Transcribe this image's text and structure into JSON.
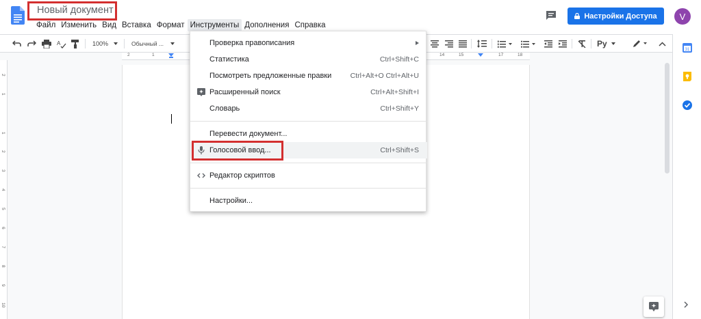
{
  "app": {
    "doc_title": "Новый документ",
    "share_label": "Настройки Доступа",
    "avatar_letter": "V",
    "accent_color": "#1a73e8",
    "highlight_box_color": "#d32f2f"
  },
  "menubar": {
    "items": [
      "Файл",
      "Изменить",
      "Вид",
      "Вставка",
      "Формат",
      "Инструменты",
      "Дополнения",
      "Справка"
    ],
    "active": "Инструменты"
  },
  "toolbar": {
    "zoom": "100%",
    "style": "Обычный ...",
    "language": "Ру",
    "icons": [
      "undo-icon",
      "redo-icon",
      "print-icon",
      "spellcheck-icon",
      "paint-format-icon",
      "align-center-icon",
      "align-right-icon",
      "align-justify-icon",
      "line-spacing-icon",
      "numbered-list-icon",
      "bulleted-list-icon",
      "decrease-indent-icon",
      "increase-indent-icon",
      "clear-formatting-icon",
      "pen-icon",
      "collapse-icon"
    ]
  },
  "ruler": {
    "top_ticks": [
      "2",
      "1",
      "14",
      "15",
      "17",
      "18"
    ],
    "left_ticks": [
      "2",
      "1",
      "1",
      "2",
      "3",
      "4",
      "5",
      "6",
      "7",
      "8",
      "9",
      "10"
    ]
  },
  "tools_menu": {
    "items": [
      {
        "label": "Проверка правописания",
        "shortcut": "",
        "submenu": true
      },
      {
        "label": "Статистика",
        "shortcut": "Ctrl+Shift+C"
      },
      {
        "label": "Посмотреть предложенные правки",
        "shortcut": "Ctrl+Alt+O Ctrl+Alt+U"
      },
      {
        "label": "Расширенный поиск",
        "shortcut": "Ctrl+Alt+Shift+I",
        "icon": "explore-icon"
      },
      {
        "label": "Словарь",
        "shortcut": "Ctrl+Shift+Y"
      },
      {
        "label": "Перевести документ...",
        "shortcut": ""
      },
      {
        "label": "Голосовой ввод...",
        "shortcut": "Ctrl+Shift+S",
        "icon": "microphone-icon",
        "highlighted": true
      },
      {
        "label": "Редактор скриптов",
        "shortcut": "",
        "icon": "code-icon"
      },
      {
        "label": "Настройки...",
        "shortcut": ""
      }
    ]
  },
  "side_panel": {
    "icons": [
      "calendar-icon",
      "keep-icon",
      "tasks-icon"
    ],
    "calendar_day": "31"
  }
}
